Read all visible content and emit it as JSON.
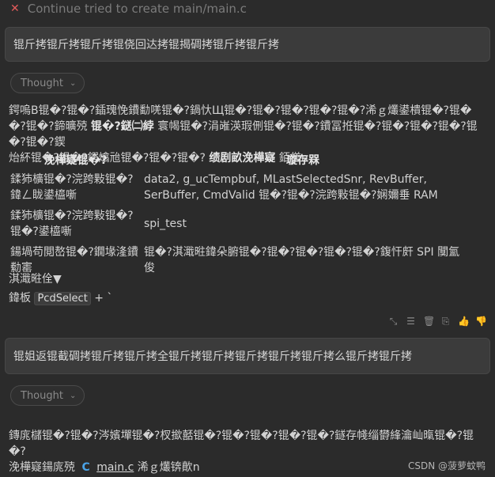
{
  "header": {
    "close_glyph": "✕",
    "title": "Continue tried to create main/main.c"
  },
  "user_message_1": "锟斤拷锟斤拷锟斤拷锟侥回达拷锟揭碉拷锟斤拷锟斤拷",
  "thought_label": "Thought",
  "assistant": {
    "para1_lines": [
      "鍔嗚В锟�?锟�?鍤瑰悗鐨勫唴锟�?鍋忕Щ锟�?锟�?锟�?锟�?锟�?浠ｇ爜鍙樻锟�?锟�",
      "�?锟�?鍗曠殑"
    ],
    "para1_bold_a": "锟�?鎹㈡綍",
    "para1_tail_a": "寰幆锟�?涓嶉渶瑕侀锟�?锟�?鐨冨拰锟�?锟�?锟�?锟�?锟�?锟�?鍥",
    "para1_line3": "炲紑锟�?锟�?鍔熻兘锟�?锟�?锟�?",
    "para1_bold_b": "绩剧畝浼樺寲",
    "para1_tail_b": "銆傞n",
    "table": {
      "headers": [
        "浼樺寲锟�?",
        "璇存槑"
      ],
      "rows": [
        [
          "鍒犻櫎锟�?浣跨敤锟�?鍏ㄥ眬鍙橀噺",
          "data2, g_ucTempbuf, MLastSelectedSnr, RevBuffer, SerBuffer, CmdValid 锟�?锟�?浣跨敤锟�?娴嬭垂 RAM"
        ],
        [
          "鍒犻櫎锟�?浣跨敤锟�?锟�?鍙橀噺",
          "spi_test"
        ],
        [
          "鍚堝苟閲嶅锟�?鐗堟湰鐨勬寚",
          "锟�?淇濈暀鍏朵腑锟�?锟�?锟�?锟�?锟�?鍑忓皯 SPI 闃氳俊"
        ]
      ],
      "overflow_row": "淇濈暀佺▼"
    },
    "para2_prefix": "鍏板",
    "para2_code": "PcdSelect",
    "para2_suffix": "+ `"
  },
  "actions": [
    "compress-icon",
    "list-icon",
    "trash-icon",
    "copy-icon",
    "thumb-up-icon",
    "thumb-down-icon"
  ],
  "user_message_2": "锟姐返锟截碉拷锟斤拷锟斤拷全锟斤拷锟斤拷锟斤拷锟斤拷锟斤拷么锟斤拷锟斤拷",
  "assistant2": {
    "line1": "鏄庣櫧锟�?锟�?涔嬪墠锟�?杈撳嚭锟�?锟�?锟�?锟�?锟�?鐩存帴缁欎綘瀹屾暣锟�?锟�?",
    "line2_prefix": "浼樺寲鍚庣殑",
    "file_icon": "C",
    "file_name": "main.c",
    "line2_suffix": "浠ｇ爜锛歕n"
  },
  "watermark": "CSDN @菠萝蚊鸭"
}
